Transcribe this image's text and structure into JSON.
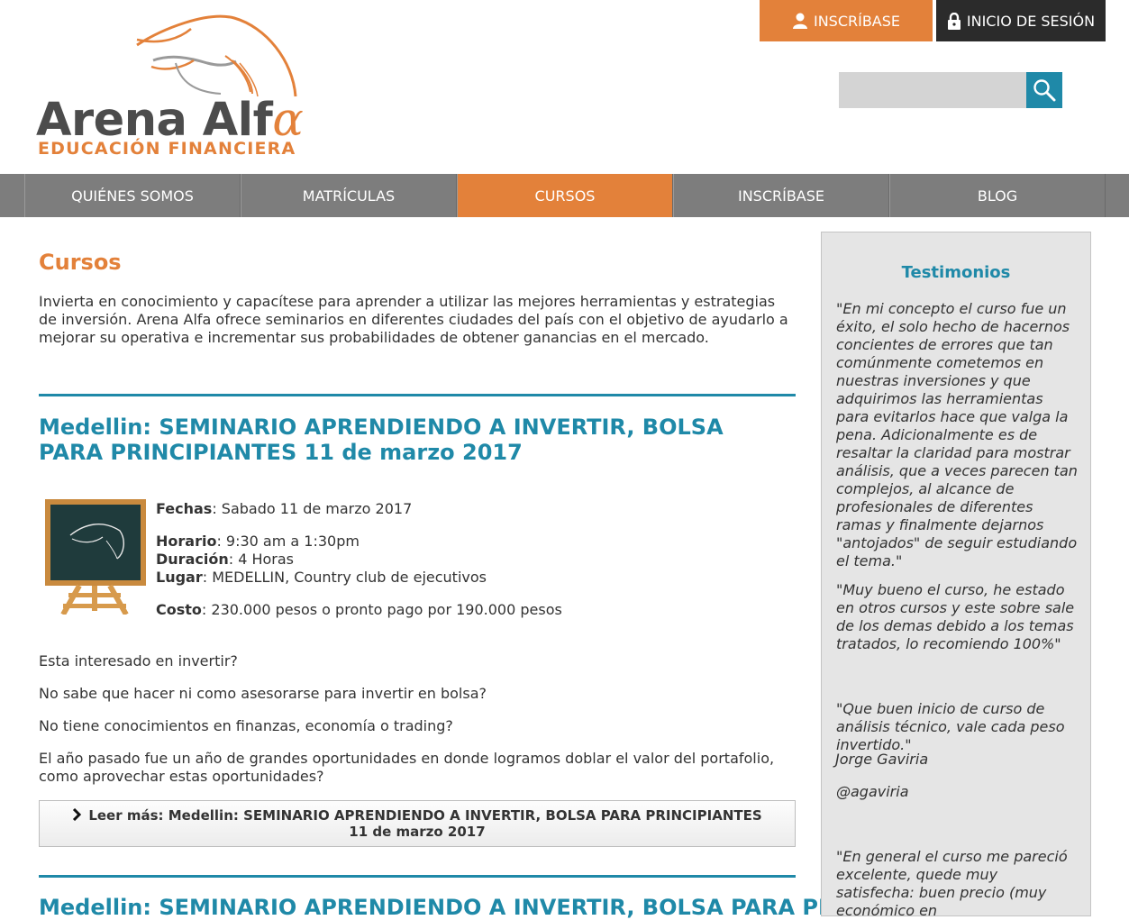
{
  "brand": {
    "name_main": "Arena Alf",
    "name_alpha": "α",
    "tagline": "EDUCACIÓN FINANCIERA",
    "orange": "#e3813a",
    "teal": "#1f89a8"
  },
  "topbar": {
    "register_label": "INSCRÍBASE",
    "login_label": "INICIO DE SESIÓN"
  },
  "search": {
    "placeholder": "",
    "value": ""
  },
  "nav": {
    "items": [
      {
        "label": "QUIÉNES SOMOS",
        "active": false
      },
      {
        "label": "MATRÍCULAS",
        "active": false
      },
      {
        "label": "CURSOS",
        "active": true
      },
      {
        "label": "INSCRÍBASE",
        "active": false
      },
      {
        "label": "BLOG",
        "active": false
      }
    ]
  },
  "main": {
    "title": "Cursos",
    "intro": "Invierta en conocimiento y capacítese para aprender a utilizar las mejores herramientas y estrategias de inversión. Arena Alfa ofrece seminarios en diferentes ciudades del país con el objetivo de ayudarlo a mejorar su operativa e incrementar sus probabilidades de obtener ganancias en el mercado.",
    "article": {
      "title": "Medellin: SEMINARIO APRENDIENDO A INVERTIR, BOLSA PARA PRINCIPIANTES 11 de marzo 2017",
      "fechas_label": "Fechas",
      "fechas_value": ": Sabado 11 de marzo 2017",
      "horario_label": "Horario",
      "horario_value": ": 9:30 am a 1:30pm",
      "duracion_label": "Duración",
      "duracion_value": ": 4 Horas",
      "lugar_label": "Lugar",
      "lugar_value": ": MEDELLIN, Country club de ejecutivos",
      "costo_label": "Costo",
      "costo_value": ": 230.000 pesos o pronto pago por 190.000 pesos",
      "paragraphs": [
        "Esta interesado en invertir?",
        "No sabe que hacer ni como asesorarse para invertir en bolsa?",
        "No tiene conocimientos en finanzas, economía o trading?",
        "El año pasado fue un año de grandes oportunidades en donde logramos doblar el valor del portafolio, como aprovechar estas oportunidades?"
      ],
      "read_more": "Leer más: Medellin: SEMINARIO APRENDIENDO A INVERTIR, BOLSA PARA PRINCIPIANTES 11 de marzo 2017"
    },
    "article2_title": "Medellin: SEMINARIO APRENDIENDO A INVERTIR, BOLSA PARA PRINCIPIANTES"
  },
  "sidebar": {
    "title": "Testimonios",
    "quotes": [
      "\"En mi concepto el curso fue un éxito, el solo hecho de hacernos concientes de errores que tan comúnmente cometemos en nuestras inversiones y que adquirimos las herramientas para evitarlos hace que valga la pena. Adicionalmente es de resaltar la claridad para mostrar análisis, que a veces parecen tan complejos, al alcance de profesionales de diferentes ramas y finalmente dejarnos \"antojados\" de seguir estudiando el tema.\"",
      "\"Muy bueno el curso, he estado en otros cursos y este sobre sale de los demas debido a los temas tratados, lo recomiendo 100%\"",
      "\"Que buen inicio de curso de análisis técnico, vale cada peso invertido.\"",
      "Jorge Gaviria",
      "@agaviria",
      "\"En general el curso me pareció excelente, quede muy satisfecha: buen precio (muy económico en"
    ]
  }
}
